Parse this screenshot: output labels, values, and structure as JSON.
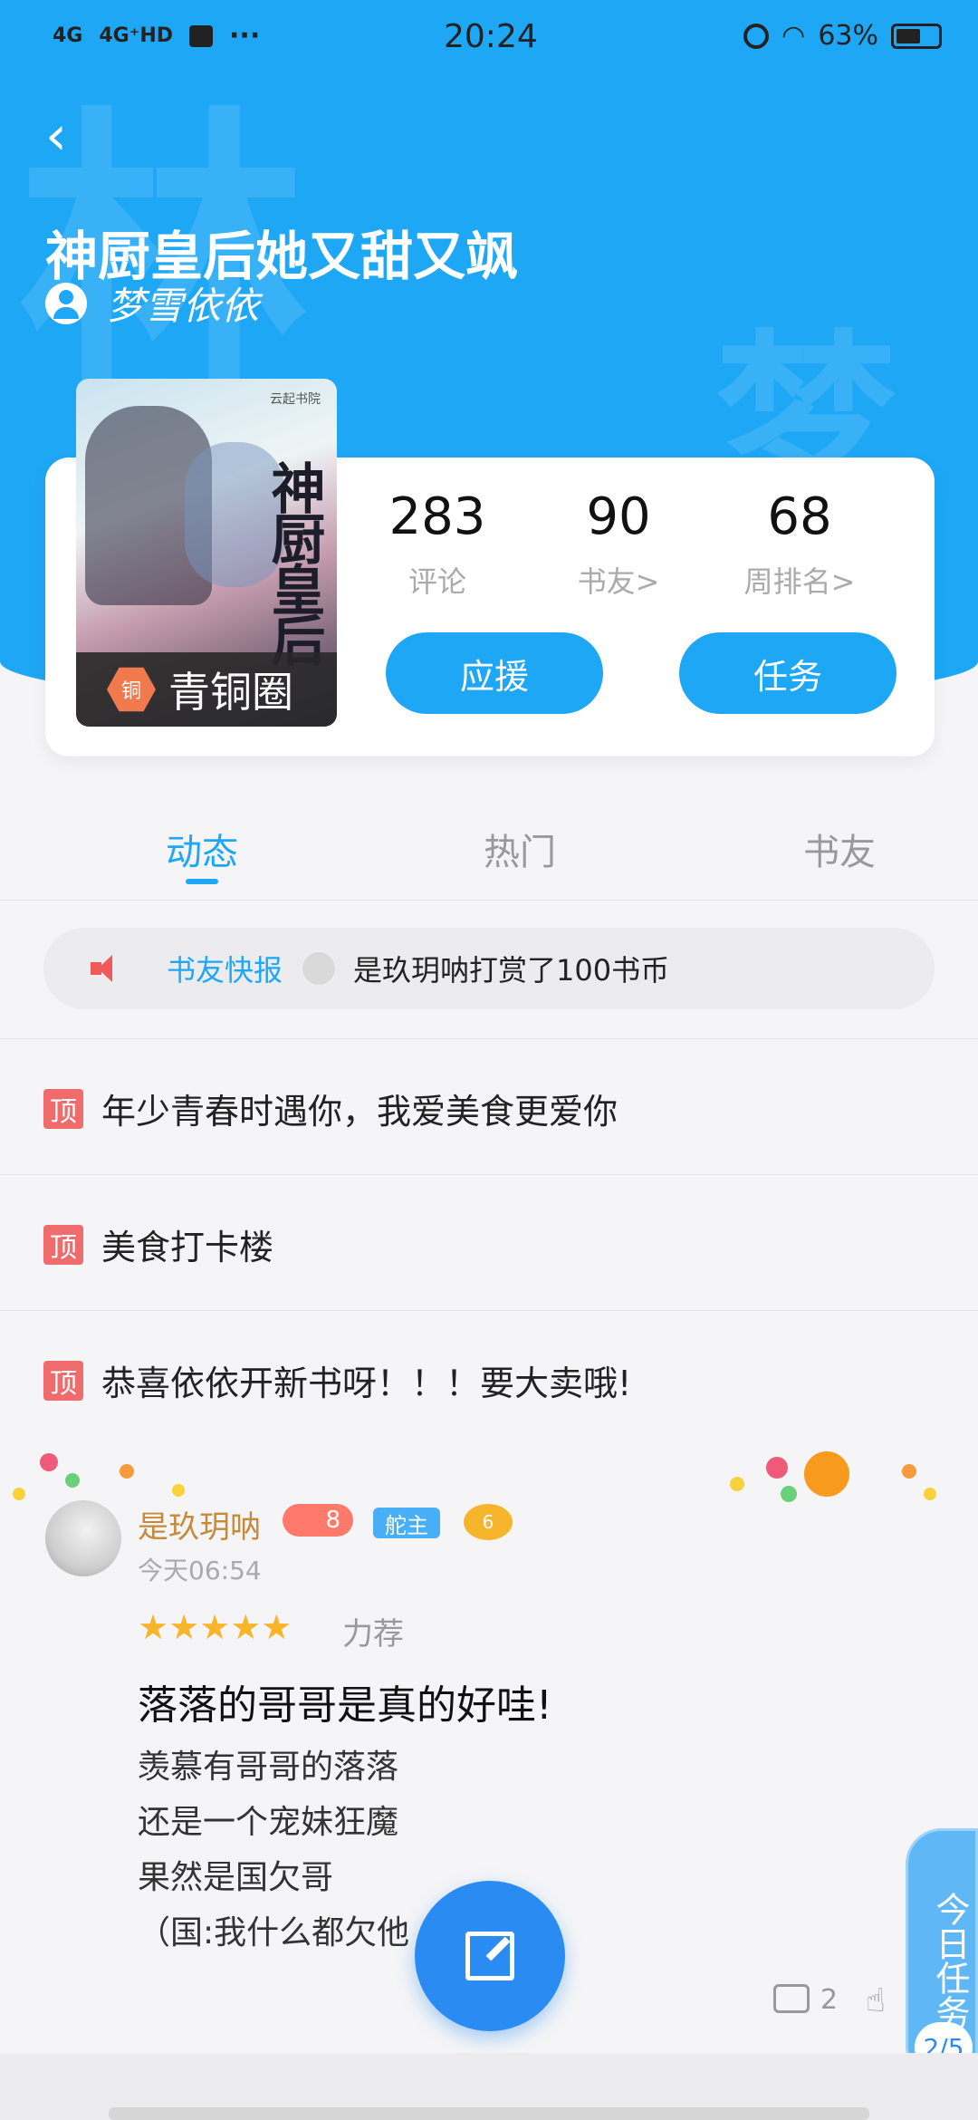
{
  "status": {
    "network1": "4G",
    "network2": "4G⁺HD",
    "more": "···",
    "time": "20:24",
    "battery": "63%"
  },
  "header": {
    "title": "神厨皇后她又甜又飒",
    "author": "梦雪依依",
    "watermark_top": "林",
    "watermark_right": "梦"
  },
  "cover": {
    "title": "神厨皇后",
    "publisher": "云起书院",
    "circle_icon": "铜",
    "circle_label": "青铜圈"
  },
  "stats": [
    {
      "value": "283",
      "label": "评论"
    },
    {
      "value": "90",
      "label": "书友>"
    },
    {
      "value": "68",
      "label": "周排名>"
    }
  ],
  "actions": {
    "support": "应援",
    "task": "任务"
  },
  "tabs": [
    "动态",
    "热门",
    "书友"
  ],
  "ticker": {
    "label": "书友快报",
    "text": "是玖玥呐打赏了100书币"
  },
  "pinned": [
    {
      "tag": "顶",
      "text": "年少青春时遇你，我爱美食更爱你"
    },
    {
      "tag": "顶",
      "text": "美食打卡楼"
    },
    {
      "tag": "顶",
      "text": "恭喜依依开新书呀！！！要大卖哦!"
    }
  ],
  "post": {
    "username": "是玖玥呐",
    "level": "8",
    "role": "舵主",
    "medal": "6",
    "time": "今天06:54",
    "stars": "★★★★★",
    "rating_label": "力荐",
    "title": "落落的哥哥是真的好哇!",
    "lines": [
      "羡慕有哥哥的落落",
      "还是一个宠妹狂魔",
      "果然是国欠哥",
      "（国:我什么都欠他"
    ],
    "comments": "2"
  },
  "task_panel": {
    "label": "今日任务",
    "progress": "2/5"
  },
  "colors": {
    "accent": "#1ea7f5",
    "pin": "#f06b6b",
    "username": "#c58b3a"
  }
}
